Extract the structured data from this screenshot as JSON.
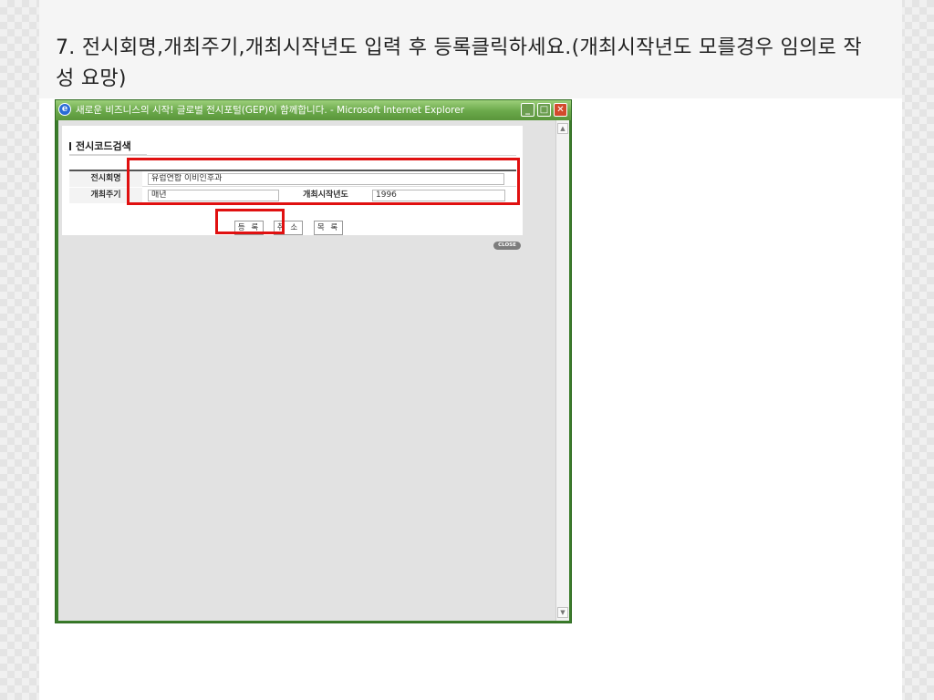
{
  "instruction": {
    "text": "7. 전시회명,개최주기,개최시작년도 입력 후 등록클릭하세요.(개최시작년도 모를경우 임의로 작성 요망)"
  },
  "browser": {
    "title": "새로운 비즈니스의 시작! 글로벌 전시포털(GEP)이 함께합니다. - Microsoft Internet Explorer",
    "icon": "ie-icon",
    "controls": [
      "minimize-icon",
      "maximize-icon",
      "close-icon"
    ],
    "frame_color": "#6aa84a"
  },
  "form": {
    "title": "전시코드검색",
    "fields": {
      "exhibition_name": {
        "label": "전시회명",
        "value": "유럽연합 이비인후과"
      },
      "cycle": {
        "label": "개최주기",
        "value": "매년"
      },
      "start_year": {
        "label": "개최시작년도",
        "value": "1996"
      }
    },
    "buttons": {
      "register": "등 록",
      "cancel": "취 소",
      "list": "목 록"
    },
    "close_label": "CLOSE"
  },
  "annotations": {
    "highlight_color": "#e01010"
  }
}
